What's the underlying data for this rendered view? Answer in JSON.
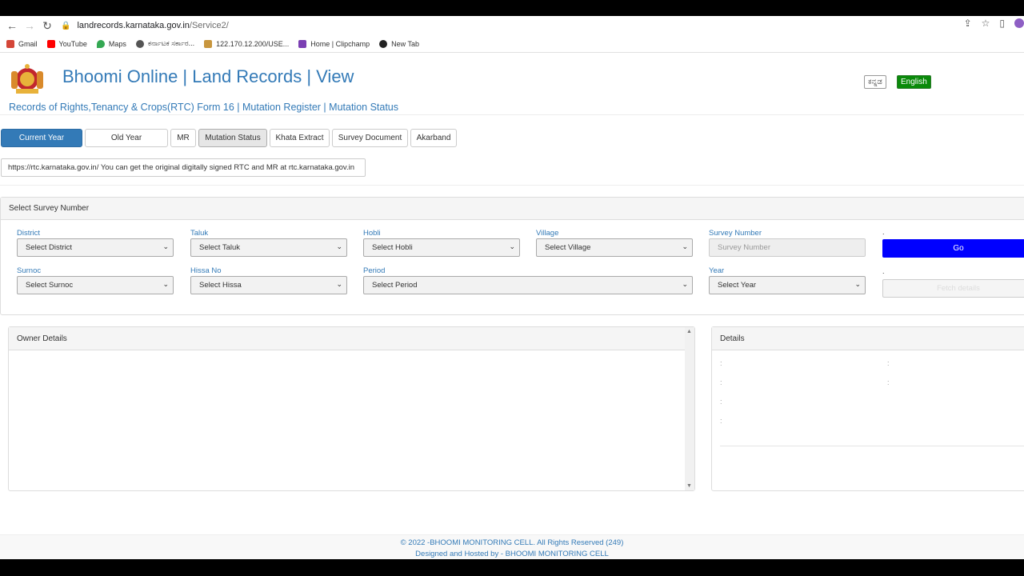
{
  "browser": {
    "url_host": "landrecords.karnataka.gov.in",
    "url_path": "/Service2/",
    "bookmarks": [
      {
        "label": "Gmail",
        "color": "#d44638"
      },
      {
        "label": "YouTube",
        "color": "#ff0000"
      },
      {
        "label": "Maps",
        "color": "#34a853"
      },
      {
        "label": "ಕರ್ನಾಟಕ ಸರ್ಕಾರ...",
        "color": "#555555"
      },
      {
        "label": "122.170.12.200/USE...",
        "color": "#c8963e"
      },
      {
        "label": "Home | Clipchamp",
        "color": "#7b3fb3"
      },
      {
        "label": "New Tab",
        "color": "#222222"
      }
    ]
  },
  "header": {
    "title": "Bhoomi Online | Land Records | View",
    "subtitle": "Records of Rights,Tenancy & Crops(RTC) Form 16 | Mutation Register | Mutation Status",
    "lang_kannada": "ಕನ್ನಡ",
    "lang_english": "English"
  },
  "tabs": [
    {
      "label": "Current Year"
    },
    {
      "label": "Old Year"
    },
    {
      "label": "MR"
    },
    {
      "label": "Mutation Status"
    },
    {
      "label": "Khata Extract"
    },
    {
      "label": "Survey Document"
    },
    {
      "label": "Akarband"
    }
  ],
  "info": "https://rtc.karnataka.gov.in/ You can get the original digitally signed RTC and MR at rtc.karnataka.gov.in",
  "survey_panel": {
    "heading": "Select Survey Number",
    "district": {
      "label": "District",
      "value": "Select District"
    },
    "taluk": {
      "label": "Taluk",
      "value": "Select Taluk"
    },
    "hobli": {
      "label": "Hobli",
      "value": "Select Hobli"
    },
    "village": {
      "label": "Village",
      "value": "Select Village"
    },
    "survey_number": {
      "label": "Survey Number",
      "placeholder": "Survey Number"
    },
    "go_label": "Go",
    "surnoc": {
      "label": "Surnoc",
      "value": "Select Surnoc"
    },
    "hissa": {
      "label": "Hissa No",
      "value": "Select Hissa"
    },
    "period": {
      "label": "Period",
      "value": "Select Period"
    },
    "year": {
      "label": "Year",
      "value": "Select Year"
    },
    "fetch_label": "Fetch details",
    "dot": "."
  },
  "owner_panel": {
    "heading": "Owner Details"
  },
  "details_panel": {
    "heading": "Details",
    "colon": ":"
  },
  "footer": {
    "line1": "© 2022 -BHOOMI MONITORING CELL. All Rights Reserved (249)",
    "line2": "Designed and Hosted by - BHOOMI MONITORING CELL"
  },
  "colors": {
    "primary": "#337ab7",
    "go": "#0000ff",
    "english": "#0a8a0a"
  }
}
